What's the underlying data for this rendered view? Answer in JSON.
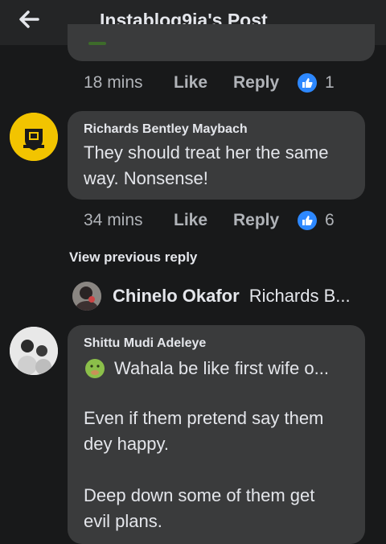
{
  "header": {
    "title": "Instablog9ja's Post"
  },
  "comment1_meta": {
    "time": "18 mins",
    "like": "Like",
    "reply": "Reply",
    "reactions": "1"
  },
  "comment2": {
    "author": "Richards Bentley Maybach",
    "text_line1": "They should treat her the same",
    "text_line2": "way. Nonsense!",
    "time": "34 mins",
    "like": "Like",
    "reply": "Reply",
    "reactions": "6"
  },
  "view_previous": "View previous reply",
  "reply_preview": {
    "name": "Chinelo Okafor",
    "preview": "Richards B..."
  },
  "comment3": {
    "author": "Shittu Mudi Adeleye",
    "line1": "Wahala be like first wife o...",
    "line2": "Even if them pretend say them",
    "line3": "dey happy.",
    "line4": "Deep down some of them get",
    "line5": "evil plans."
  },
  "colors": {
    "background": "#18191a",
    "bubble": "#3a3b3c",
    "accent": "#2d88ff"
  },
  "icons": [
    "back-arrow-icon",
    "like-reaction-icon",
    "emoji-icon"
  ]
}
